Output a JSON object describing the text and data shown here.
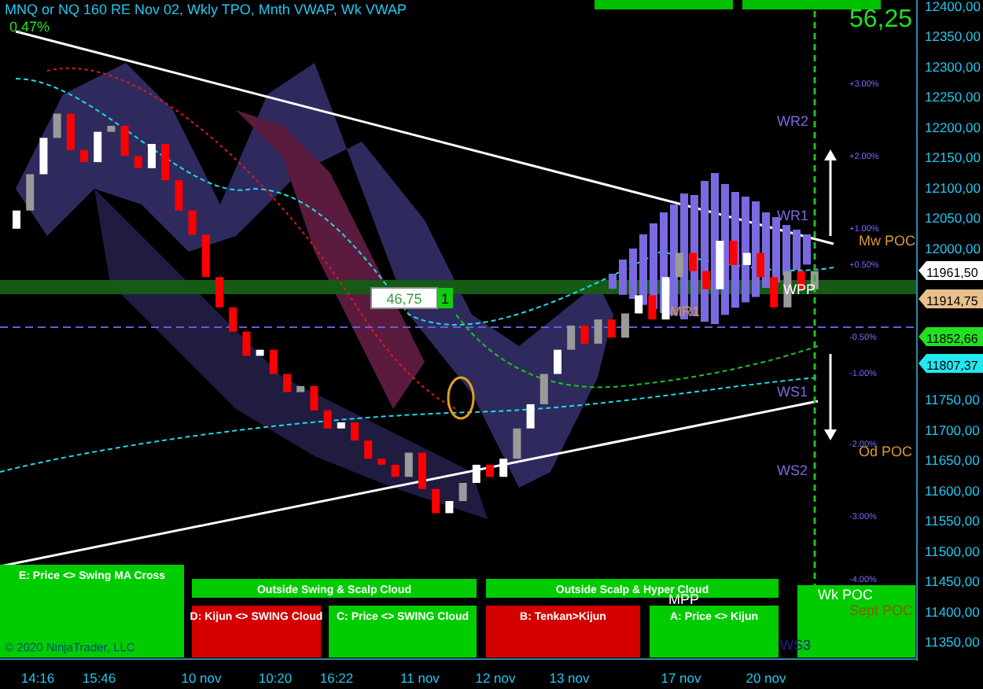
{
  "header": {
    "title": "MNQ or NQ 160 RE Nov 02, Wkly TPO, Mnth VWAP, Wk VWAP",
    "change": "0,47%"
  },
  "price_delta": "56,25",
  "order": {
    "price": "46,75",
    "quantity": "1"
  },
  "price_axis": {
    "ticks": [
      "12400,00",
      "12350,00",
      "12300,00",
      "12250,00",
      "12200,00",
      "12150,00",
      "12100,00",
      "12050,00",
      "12000,00",
      "11750,00",
      "11700,00",
      "11650,00",
      "11600,00",
      "11550,00",
      "11500,00",
      "11450,00",
      "11400,00",
      "11350,00"
    ]
  },
  "price_tags": [
    {
      "label": "11961,50",
      "color": "#ffffff"
    },
    {
      "label": "11914,75",
      "color": "#e8c08c"
    },
    {
      "label": "11852,66",
      "color": "#22e022"
    },
    {
      "label": "11807,37",
      "color": "#22e8f0"
    }
  ],
  "levels": [
    {
      "label": "WR2",
      "kind": "pivot"
    },
    {
      "label": "WR1",
      "kind": "pivot"
    },
    {
      "label": "Mw POC",
      "kind": "poc"
    },
    {
      "label": "WPP",
      "kind": "main"
    },
    {
      "label": "MR1",
      "kind": "poc"
    },
    {
      "label": "WS1",
      "kind": "pivot"
    },
    {
      "label": "WS2",
      "kind": "pivot"
    },
    {
      "label": "Od POC",
      "kind": "poc"
    },
    {
      "label": "MPP",
      "kind": "main"
    },
    {
      "label": "Wk POC",
      "kind": "main"
    },
    {
      "label": "Sept POC",
      "kind": "poc"
    },
    {
      "label": "WS3",
      "kind": "pivot"
    }
  ],
  "percent_marks": [
    "+3.00%",
    "+2.00%",
    "+1.00%",
    "+0.50%",
    "-0.50%",
    "-1.00%",
    "-2.00%",
    "-3.00%",
    "-4.00%"
  ],
  "signal_panels": [
    {
      "label": "E: Price <> Swing MA Cross",
      "color": "#00cc00"
    },
    {
      "label": "Outside Swing & Scalp Cloud",
      "color": "#00cc00"
    },
    {
      "label": "Outside Scalp & Hyper Cloud",
      "color": "#00cc00"
    },
    {
      "label": "D: Kijun <> SWING Cloud",
      "color": "#d40000"
    },
    {
      "label": "C: Price <> SWING Cloud",
      "color": "#00cc00"
    },
    {
      "label": "B: Tenkan>Kijun",
      "color": "#d40000"
    },
    {
      "label": "A: Price <> Kijun",
      "color": "#00cc00"
    }
  ],
  "time_axis": {
    "ticks": [
      "14:16",
      "15:46",
      "10 nov",
      "10:20",
      "16:22",
      "11 nov",
      "12 nov",
      "13 nov",
      "17 nov",
      "20 nov"
    ]
  },
  "copyright": "© 2020 NinjaTrader, LLC"
}
